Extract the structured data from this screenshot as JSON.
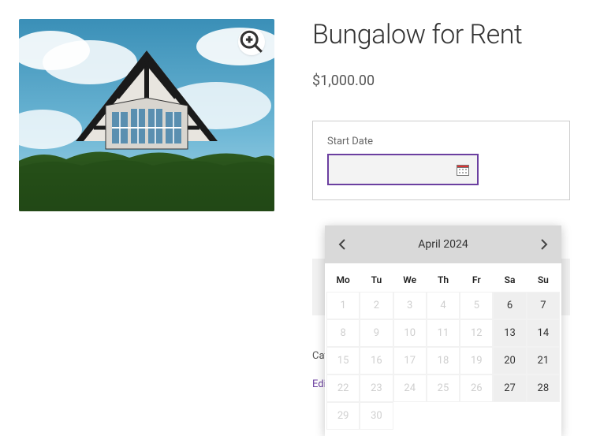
{
  "product": {
    "title": "Bungalow for Rent",
    "price": "$1,000.00"
  },
  "form": {
    "start_date_label": "Start Date"
  },
  "meta": {
    "category_label": "Cat",
    "edit_label": "Edi"
  },
  "calendar": {
    "title": "April 2024",
    "dow": [
      "Mo",
      "Tu",
      "We",
      "Th",
      "Fr",
      "Sa",
      "Su"
    ],
    "weeks": [
      [
        {
          "n": 1,
          "s": "d"
        },
        {
          "n": 2,
          "s": "d"
        },
        {
          "n": 3,
          "s": "d"
        },
        {
          "n": 4,
          "s": "d"
        },
        {
          "n": 5,
          "s": "d"
        },
        {
          "n": 6,
          "s": "a"
        },
        {
          "n": 7,
          "s": "a"
        }
      ],
      [
        {
          "n": 8,
          "s": "d"
        },
        {
          "n": 9,
          "s": "d"
        },
        {
          "n": 10,
          "s": "d"
        },
        {
          "n": 11,
          "s": "d"
        },
        {
          "n": 12,
          "s": "d"
        },
        {
          "n": 13,
          "s": "a"
        },
        {
          "n": 14,
          "s": "a"
        }
      ],
      [
        {
          "n": 15,
          "s": "d"
        },
        {
          "n": 16,
          "s": "d"
        },
        {
          "n": 17,
          "s": "d"
        },
        {
          "n": 18,
          "s": "d"
        },
        {
          "n": 19,
          "s": "d"
        },
        {
          "n": 20,
          "s": "a"
        },
        {
          "n": 21,
          "s": "a"
        }
      ],
      [
        {
          "n": 22,
          "s": "d"
        },
        {
          "n": 23,
          "s": "d"
        },
        {
          "n": 24,
          "s": "d"
        },
        {
          "n": 25,
          "s": "d"
        },
        {
          "n": 26,
          "s": "d"
        },
        {
          "n": 27,
          "s": "a"
        },
        {
          "n": 28,
          "s": "a"
        }
      ],
      [
        {
          "n": 29,
          "s": "d"
        },
        {
          "n": 30,
          "s": "d"
        },
        {
          "n": null,
          "s": "e"
        },
        {
          "n": null,
          "s": "e"
        },
        {
          "n": null,
          "s": "e"
        },
        {
          "n": null,
          "s": "e"
        },
        {
          "n": null,
          "s": "e"
        }
      ]
    ]
  }
}
